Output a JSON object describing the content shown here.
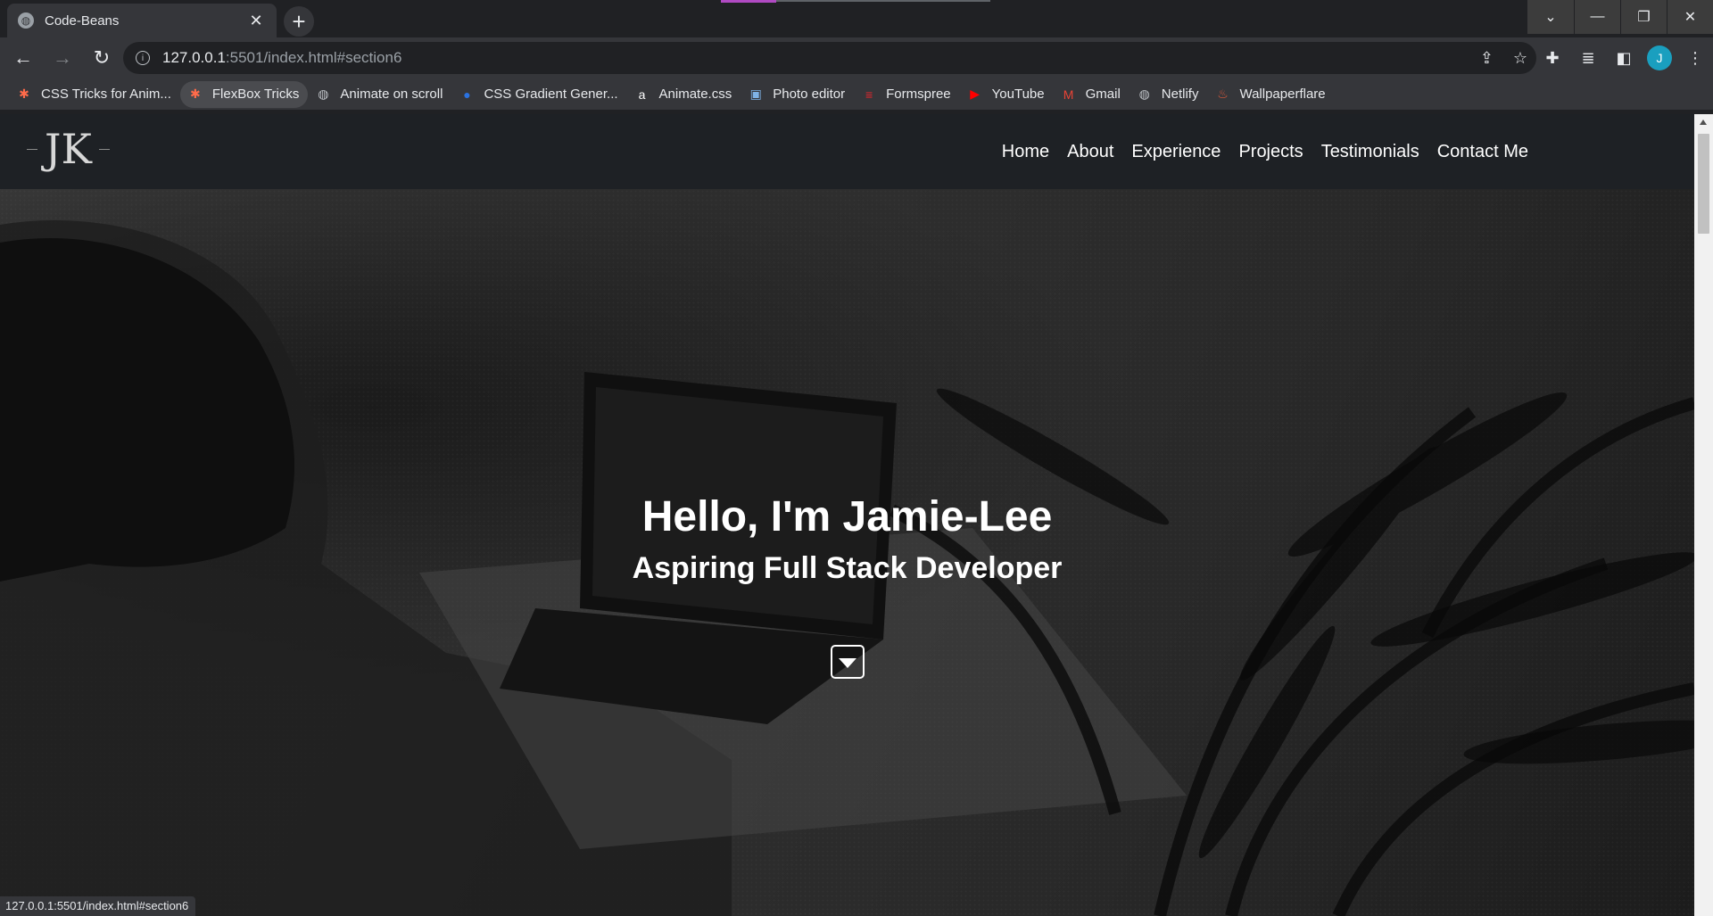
{
  "browser": {
    "tab": {
      "title": "Code-Beans",
      "close": "✕"
    },
    "new_tab": "+",
    "window_controls": {
      "dropdown": "⌄",
      "minimize": "—",
      "maximize": "❐",
      "close": "✕"
    },
    "nav": {
      "back": "←",
      "forward": "→",
      "reload": "↻"
    },
    "address": {
      "host": "127.0.0.1",
      "rest": ":5501/index.html#section6"
    },
    "profile_initial": "J",
    "bookmarks": [
      {
        "label": "CSS Tricks for Anim...",
        "icon": "asterisk-icon",
        "glyph": "✱",
        "color": "#ff6b4a"
      },
      {
        "label": "FlexBox Tricks",
        "icon": "asterisk-icon",
        "glyph": "✱",
        "color": "#ff6b4a"
      },
      {
        "label": "Animate on scroll",
        "icon": "globe-icon",
        "glyph": "◍",
        "color": "#bdc1c6"
      },
      {
        "label": "CSS Gradient Gener...",
        "icon": "gradient-icon",
        "glyph": "●",
        "color": "#2a72e0"
      },
      {
        "label": "Animate.css",
        "icon": "a-icon",
        "glyph": "a",
        "color": "#ffffff"
      },
      {
        "label": "Photo editor",
        "icon": "photo-icon",
        "glyph": "▣",
        "color": "#7fb3e6"
      },
      {
        "label": "Formspree",
        "icon": "formspree-icon",
        "glyph": "≡",
        "color": "#e5252c"
      },
      {
        "label": "YouTube",
        "icon": "youtube-icon",
        "glyph": "▶",
        "color": "#ff0000"
      },
      {
        "label": "Gmail",
        "icon": "gmail-icon",
        "glyph": "M",
        "color": "#ea4335"
      },
      {
        "label": "Netlify",
        "icon": "globe-icon",
        "glyph": "◍",
        "color": "#bdc1c6"
      },
      {
        "label": "Wallpaperflare",
        "icon": "flame-icon",
        "glyph": "♨",
        "color": "#e05a3a"
      }
    ],
    "active_bookmark_index": 1,
    "status_url": "127.0.0.1:5501/index.html#section6"
  },
  "site": {
    "logo": "JK",
    "nav_links": [
      "Home",
      "About",
      "Experience",
      "Projects",
      "Testimonials",
      "Contact Me"
    ],
    "hero": {
      "title": "Hello, I'm Jamie-Lee",
      "subtitle": "Aspiring Full Stack Developer"
    }
  },
  "colors": {
    "chrome_bg": "#202124",
    "toolbar_bg": "#35363a",
    "site_nav_bg": "#1e2125",
    "avatar": "#1a9fbf",
    "accent_tab_indicator": "#b04ac2"
  }
}
